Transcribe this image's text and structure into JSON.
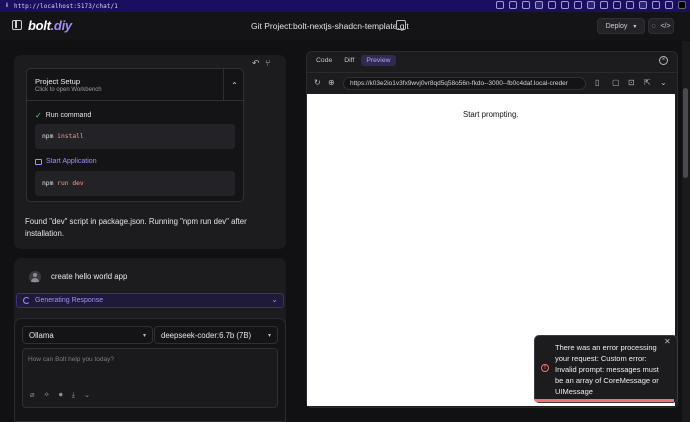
{
  "browser": {
    "url": "http://localhost:5173/chat/1"
  },
  "header": {
    "logo_main": "bolt",
    "logo_accent": ".diy",
    "project_title": "Git Project:bolt-nextjs-shadcn-template.git",
    "deploy_label": "Deploy"
  },
  "chat": {
    "setup_title": "Project Setup",
    "setup_subtitle": "Click to open Workbench",
    "run_command_label": "Run command",
    "run_command_cmd": "npm",
    "run_command_arg": "install",
    "start_app_label": "Start Application",
    "start_app_cmd": "npm",
    "start_app_arg": "run dev",
    "assistant_text": "Found \"dev\" script in package.json. Running \"npm run dev\" after installation.",
    "user_message": "create hello world app",
    "generating_label": "Generating Response"
  },
  "input": {
    "provider": "Ollama",
    "model": "deepseek-coder:6.7b (7B)",
    "placeholder": "How can Bolt help you today?"
  },
  "workbench": {
    "tabs": [
      "Code",
      "Diff",
      "Preview"
    ],
    "active_tab": "Preview",
    "preview_url": "https://k03e2io1v3fx9wvj0vr8qd5q58o56n-fkdo--3000--fb0c4daf.local-creder",
    "preview_text": "Start prompting."
  },
  "toast": {
    "message": "There was an error processing your request: Custom error: Invalid prompt: messages must be an array of CoreMessage or UIMessage"
  }
}
